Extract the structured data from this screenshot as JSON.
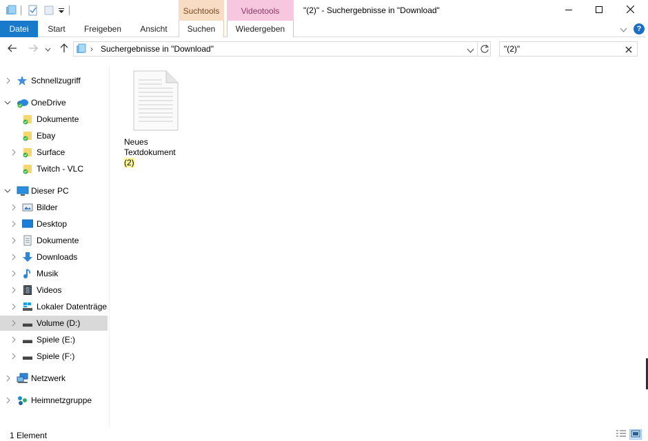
{
  "window": {
    "title": "\"(2)\" - Suchergebnisse in \"Download\"",
    "context_tab_groups": {
      "search": "Suchtools",
      "video": "Videotools"
    }
  },
  "ribbon": {
    "tabs": {
      "datei": "Datei",
      "start": "Start",
      "freigeben": "Freigeben",
      "ansicht": "Ansicht",
      "suchen": "Suchen",
      "wiedergeben": "Wiedergeben"
    },
    "help_glyph": "?"
  },
  "address": {
    "separator": "›",
    "path": "Suchergebnisse in \"Download\""
  },
  "search": {
    "value": "\"(2)\""
  },
  "navpane": {
    "quick_access": "Schnellzugriff",
    "onedrive": "OneDrive",
    "onedrive_items": [
      "Dokumente",
      "Ebay",
      "Surface",
      "Twitch - VLC"
    ],
    "this_pc": "Dieser PC",
    "pc_items": [
      "Bilder",
      "Desktop",
      "Dokumente",
      "Downloads",
      "Musik",
      "Videos",
      "Lokaler Datenträger",
      "Volume (D:)",
      "Spiele (E:)",
      "Spiele (F:)"
    ],
    "network": "Netzwerk",
    "homegroup": "Heimnetzgruppe",
    "selected": "Volume (D:)"
  },
  "content": {
    "file": {
      "line1": "Neues",
      "line2": "Textdokument",
      "line3": "(2)"
    }
  },
  "status": {
    "count": "1 Element"
  },
  "colors": {
    "accent": "#1979ca",
    "search_tab": "#f9dcc4",
    "video_tab": "#f7c6df",
    "highlight": "#fff79c",
    "selection": "#d9d9d9"
  }
}
